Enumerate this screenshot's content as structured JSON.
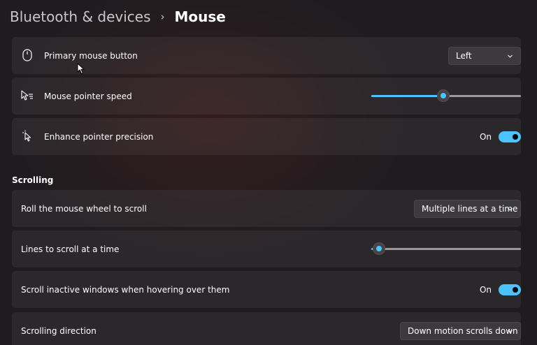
{
  "breadcrumb": {
    "parent": "Bluetooth & devices",
    "separator": "›",
    "current": "Mouse"
  },
  "settings": {
    "primary_button": {
      "label": "Primary mouse button",
      "icon": "mouse-icon",
      "value": "Left"
    },
    "pointer_speed": {
      "label": "Mouse pointer speed",
      "icon": "pointer-speed-icon",
      "level": 0.48
    },
    "pointer_precision": {
      "label": "Enhance pointer precision",
      "icon": "pointer-precision-icon",
      "state": "On"
    }
  },
  "scrolling": {
    "title": "Scrolling",
    "wheel_mode": {
      "label": "Roll the mouse wheel to scroll",
      "value": "Multiple lines at a time"
    },
    "lines": {
      "label": "Lines to scroll at a time",
      "level": 0.05
    },
    "inactive": {
      "label": "Scroll inactive windows when hovering over them",
      "state": "On"
    },
    "direction": {
      "label": "Scrolling direction",
      "value": "Down motion scrolls down"
    }
  },
  "colors": {
    "accent": "#4cc2ff",
    "card": "#2c2a2d",
    "background": "#1e1c1f"
  }
}
